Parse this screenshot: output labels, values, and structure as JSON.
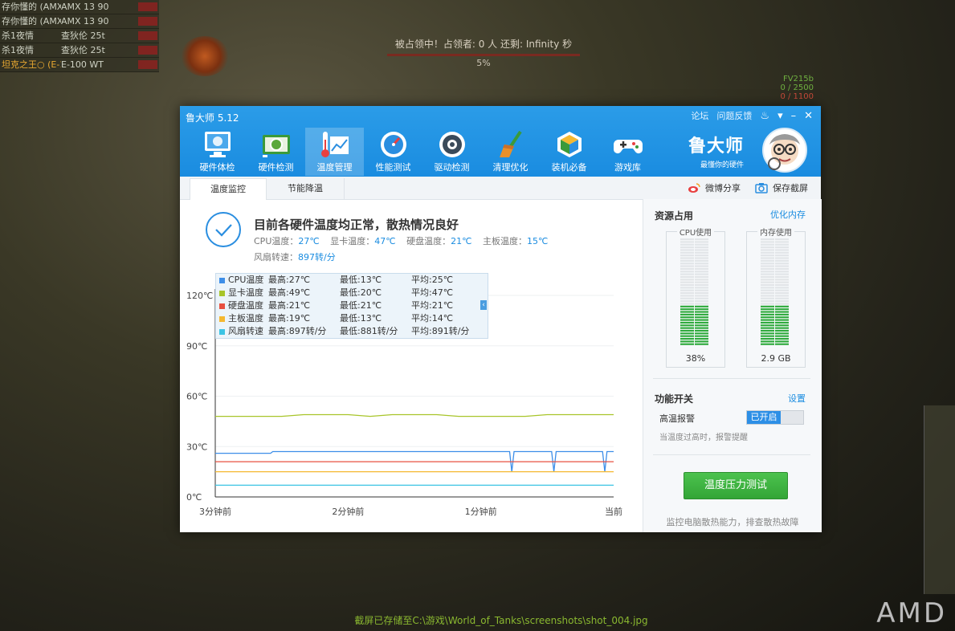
{
  "game": {
    "scoreboard": [
      {
        "player": "存你懂的 (AMX",
        "tank": "AMX 13 90"
      },
      {
        "player": "存你懂的 (AMX",
        "tank": "AMX 13 90"
      },
      {
        "player": "杀1夜情",
        "tank": "查狄伦 25t"
      },
      {
        "player": "杀1夜情",
        "tank": "查狄伦 25t"
      },
      {
        "player": "坦克之王○ (E-10",
        "tank": "E-100 WT"
      }
    ],
    "capture_text": "被占领中！占领者: 0 人  还剩: Infinity 秒",
    "capture_pct": "5%",
    "enemy_name": "FV215b",
    "enemy_hp": "0 / 2500",
    "enemy_hp2": "0 / 1100",
    "screenshot_saved": "截屏已存储至C:\\游戏\\World_of_Tanks\\screenshots\\shot_004.jpg",
    "brand_watermark": "AMD"
  },
  "app": {
    "title": "鲁大师 5.12",
    "window_links": {
      "forum": "论坛",
      "feedback": "问题反馈"
    },
    "nav": [
      {
        "label": "硬件体检",
        "icon": "monitor-check-icon"
      },
      {
        "label": "硬件检测",
        "icon": "gpu-card-icon"
      },
      {
        "label": "温度管理",
        "icon": "thermometer-chart-icon",
        "active": true
      },
      {
        "label": "性能测试",
        "icon": "speedometer-icon"
      },
      {
        "label": "驱动检测",
        "icon": "driver-gear-icon"
      },
      {
        "label": "清理优化",
        "icon": "broom-icon"
      },
      {
        "label": "装机必备",
        "icon": "package-cube-icon"
      },
      {
        "label": "游戏库",
        "icon": "gamepad-icon"
      }
    ],
    "brand": {
      "name": "鲁大师",
      "slogan": "最懂你的硬件"
    },
    "subtabs": [
      "温度监控",
      "节能降温"
    ],
    "actions": {
      "share": "微博分享",
      "save": "保存截屏"
    }
  },
  "monitor": {
    "status_title": "目前各硬件温度均正常，散热情况良好",
    "temps": [
      {
        "label": "CPU温度：",
        "value": "27℃"
      },
      {
        "label": "显卡温度：",
        "value": "47℃"
      },
      {
        "label": "硬盘温度：",
        "value": "21℃"
      },
      {
        "label": "主板温度：",
        "value": "15℃"
      }
    ],
    "fan_label": "风扇转速：",
    "fan_value": "897转/分",
    "legend": [
      {
        "name": "CPU温度",
        "max": "最高:27℃",
        "min": "最低:13℃",
        "avg": "平均:25℃",
        "color": "#3d8ee8"
      },
      {
        "name": "显卡温度",
        "max": "最高:49℃",
        "min": "最低:20℃",
        "avg": "平均:47℃",
        "color": "#a8c52a"
      },
      {
        "name": "硬盘温度",
        "max": "最高:21℃",
        "min": "最低:21℃",
        "avg": "平均:21℃",
        "color": "#e85040"
      },
      {
        "name": "主板温度",
        "max": "最高:19℃",
        "min": "最低:13℃",
        "avg": "平均:14℃",
        "color": "#f5b830"
      },
      {
        "name": "风扇转速",
        "max": "最高:897转/分",
        "min": "最低:881转/分",
        "avg": "平均:891转/分",
        "color": "#3cc4e4"
      }
    ]
  },
  "chart_data": {
    "type": "line",
    "y_ticks": [
      "0℃",
      "30℃",
      "60℃",
      "90℃",
      "120℃"
    ],
    "ylim": [
      0,
      120
    ],
    "x_ticks": [
      "3分钟前",
      "2分钟前",
      "1分钟前",
      "当前"
    ],
    "xlim": [
      0,
      180
    ],
    "series": [
      {
        "name": "显卡温度",
        "color": "#a8c52a",
        "x": [
          0,
          10,
          20,
          30,
          40,
          50,
          60,
          70,
          80,
          90,
          100,
          110,
          120,
          130,
          140,
          150,
          160,
          170,
          180
        ],
        "values": [
          48,
          48,
          48,
          48,
          49,
          49,
          49,
          48,
          49,
          49,
          49,
          48,
          48,
          48,
          48,
          49,
          49,
          49,
          49
        ]
      },
      {
        "name": "CPU温度",
        "color": "#3d8ee8",
        "x": [
          0,
          25,
          26,
          72,
          132,
          133,
          134,
          135,
          151,
          152,
          153,
          154,
          175,
          176,
          177,
          178,
          180
        ],
        "values": [
          26,
          26,
          27,
          27,
          27,
          27,
          15,
          27,
          27,
          27,
          15,
          27,
          27,
          15,
          27,
          27,
          27
        ]
      },
      {
        "name": "硬盘温度",
        "color": "#e85040",
        "x": [
          0,
          180
        ],
        "values": [
          21,
          21
        ]
      },
      {
        "name": "主板温度",
        "color": "#f5b830",
        "x": [
          0,
          180
        ],
        "values": [
          15,
          15
        ]
      },
      {
        "name": "风扇转速",
        "color": "#3cc4e4",
        "x": [
          0,
          180
        ],
        "values": [
          7,
          7
        ]
      }
    ]
  },
  "resources": {
    "title": "资源占用",
    "optimize": "优化内存",
    "cpu": {
      "label": "CPU使用",
      "value": "38%",
      "fraction": 0.38
    },
    "mem": {
      "label": "内存使用",
      "value": "2.9 GB",
      "fraction": 0.38
    }
  },
  "functions": {
    "title": "功能开关",
    "settings": "设置",
    "alarm_label": "高温报警",
    "alarm_state": "已开启",
    "alarm_desc": "当温度过高时，报警提醒",
    "stress_button": "温度压力测试",
    "footer": "监控电脑散热能力，排查散热故障"
  }
}
